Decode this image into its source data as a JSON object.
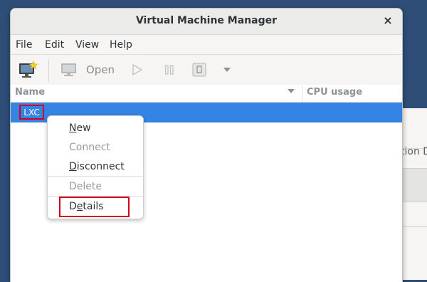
{
  "window": {
    "title": "Virtual Machine Manager",
    "close_glyph": "×"
  },
  "menubar": [
    "File",
    "Edit",
    "View",
    "Help"
  ],
  "toolbar": {
    "new_vm_icon": "new-vm-icon",
    "open_label": "Open",
    "run_icon": "play-icon",
    "pause_icon": "pause-icon",
    "shutdown_icon": "shutdown-icon",
    "dropdown_icon": "chevron-down-icon"
  },
  "list": {
    "columns": [
      "Name",
      "CPU usage"
    ],
    "connection": "LXC",
    "selected_color": "#3584e4"
  },
  "context_menu": {
    "items": [
      {
        "underline": "N",
        "rest": "ew",
        "enabled": true
      },
      {
        "underline": "",
        "rest": "Connect",
        "enabled": false
      },
      {
        "underline": "D",
        "rest": "isconnect",
        "enabled": true
      },
      {
        "underline": "",
        "rest": "Delete",
        "enabled": false
      },
      {
        "pre": "D",
        "underline": "e",
        "rest": "tails",
        "enabled": true
      }
    ]
  },
  "background_window": {
    "column_fragment": "tion D"
  },
  "annotation": {
    "highlight_color": "#d0021b"
  }
}
